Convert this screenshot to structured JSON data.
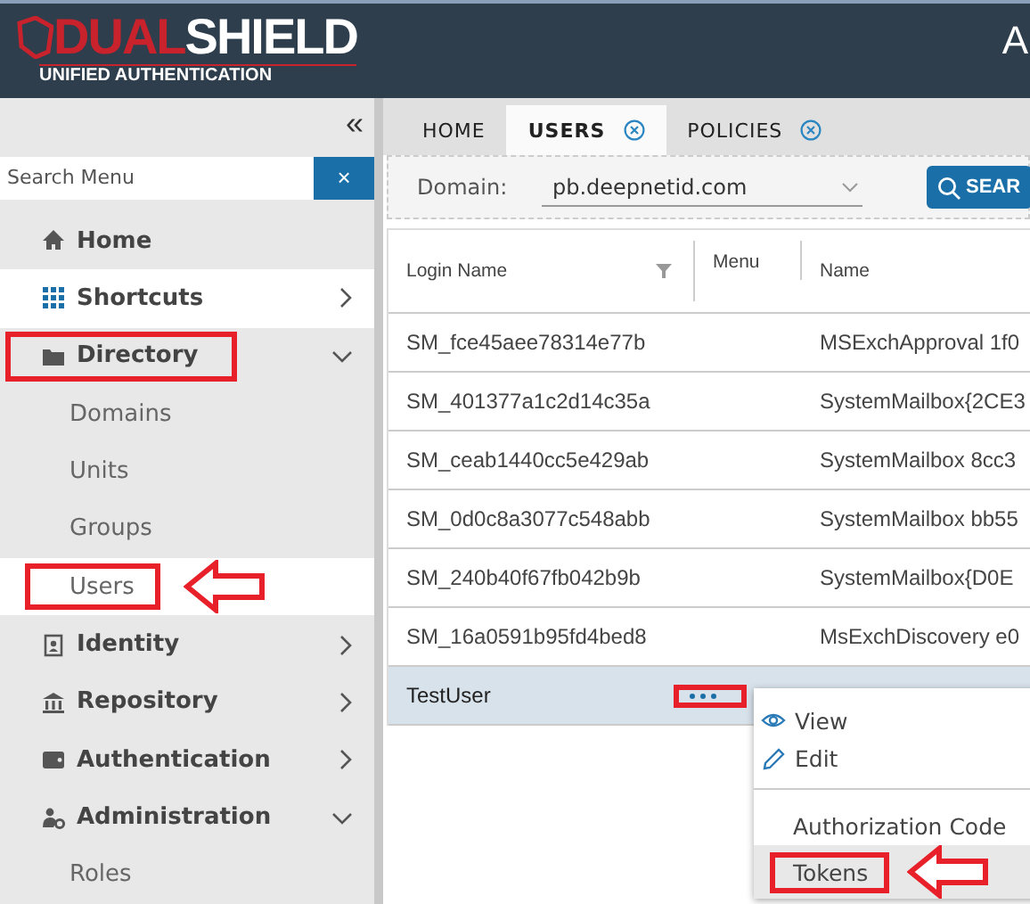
{
  "header": {
    "logo_primary": "DUAL",
    "logo_secondary": "SHIELD",
    "logo_subtitle": "UNIFIED AUTHENTICATION",
    "title_fragment": "A"
  },
  "sidebar": {
    "collapse": "«",
    "search": {
      "placeholder": "Search Menu"
    },
    "clear": "×",
    "items": [
      {
        "label": "Home",
        "selected": false,
        "boxed": false,
        "arrowed": false
      },
      {
        "label": "Shortcuts",
        "selected": true,
        "expanded": false,
        "boxed": false,
        "arrowed": false
      },
      {
        "label": "Directory",
        "selected": false,
        "expanded": true,
        "boxed": true,
        "arrowed": false,
        "children": [
          {
            "label": "Domains",
            "selected": false,
            "boxed": false,
            "arrowed": false
          },
          {
            "label": "Units",
            "selected": false,
            "boxed": false,
            "arrowed": false
          },
          {
            "label": "Groups",
            "selected": false,
            "boxed": false,
            "arrowed": false
          },
          {
            "label": "Users",
            "selected": true,
            "boxed": true,
            "arrowed": true
          }
        ]
      },
      {
        "label": "Identity",
        "selected": false,
        "expanded": false,
        "boxed": false,
        "arrowed": false
      },
      {
        "label": "Repository",
        "selected": false,
        "expanded": false,
        "boxed": false,
        "arrowed": false
      },
      {
        "label": "Authentication",
        "selected": false,
        "expanded": false,
        "boxed": false,
        "arrowed": false
      },
      {
        "label": "Administration",
        "selected": false,
        "expanded": true,
        "boxed": false,
        "arrowed": false,
        "children": [
          {
            "label": "Roles",
            "selected": false,
            "boxed": false,
            "arrowed": false
          }
        ]
      }
    ]
  },
  "tabs": [
    {
      "label": "HOME",
      "selected": false,
      "closable": false
    },
    {
      "label": "USERS",
      "selected": true,
      "closable": true
    },
    {
      "label": "POLICIES",
      "selected": false,
      "closable": true
    }
  ],
  "filter": {
    "label": "Domain:",
    "value": "pb.deepnetid.com",
    "button": "SEAR"
  },
  "table": {
    "columns": [
      "Login Name",
      "Menu",
      "Name"
    ],
    "rows": [
      {
        "login": "SM_fce45aee78314e77b",
        "name": "MSExchApproval 1f0",
        "selected": false
      },
      {
        "login": "SM_401377a1c2d14c35a",
        "name": "SystemMailbox{2CE3",
        "selected": false
      },
      {
        "login": "SM_ceab1440cc5e429ab",
        "name": "SystemMailbox 8cc3",
        "selected": false
      },
      {
        "login": "SM_0d0c8a3077c548abb",
        "name": "SystemMailbox bb55",
        "selected": false
      },
      {
        "login": "SM_240b40f67fb042b9b",
        "name": "SystemMailbox{D0E",
        "selected": false
      },
      {
        "login": "SM_16a0591b95fd4bed8",
        "name": "MsExchDiscovery e0",
        "selected": false
      },
      {
        "login": "TestUser",
        "selected": true,
        "menu_open": true,
        "boxed": true
      }
    ]
  },
  "context_menu": {
    "items": [
      {
        "label": "View",
        "hovered": false,
        "boxed": false,
        "arrowed": false
      },
      {
        "label": "Edit",
        "hovered": false,
        "boxed": false,
        "arrowed": false
      },
      {
        "kind": "divider"
      },
      {
        "label": "Authorization Code",
        "hovered": false,
        "boxed": false,
        "arrowed": false
      },
      {
        "label": "Tokens",
        "hovered": true,
        "boxed": true,
        "arrowed": true
      }
    ]
  }
}
